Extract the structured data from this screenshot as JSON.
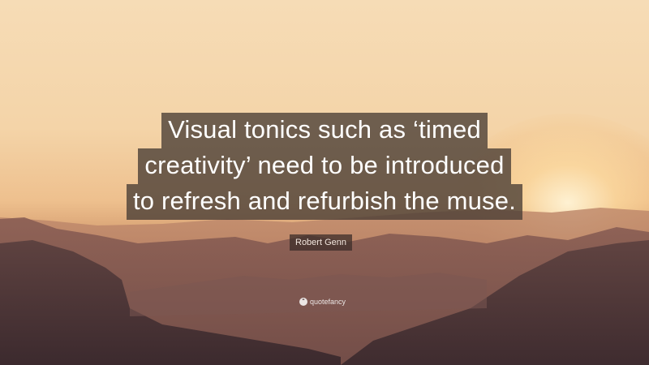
{
  "quote": {
    "lines": [
      "Visual tonics such as ‘timed",
      "creativity’ need to be introduced",
      "to refresh and refurbish the muse."
    ],
    "author": "Robert Genn"
  },
  "brand": {
    "icon": "quote-icon",
    "icon_glyph": "“",
    "name": "quotefancy"
  },
  "colors": {
    "sky_top": "#f6dcb6",
    "sky_horizon": "#eec08e",
    "mountain_dark": "#4a3436",
    "quote_box": "#483c34"
  }
}
